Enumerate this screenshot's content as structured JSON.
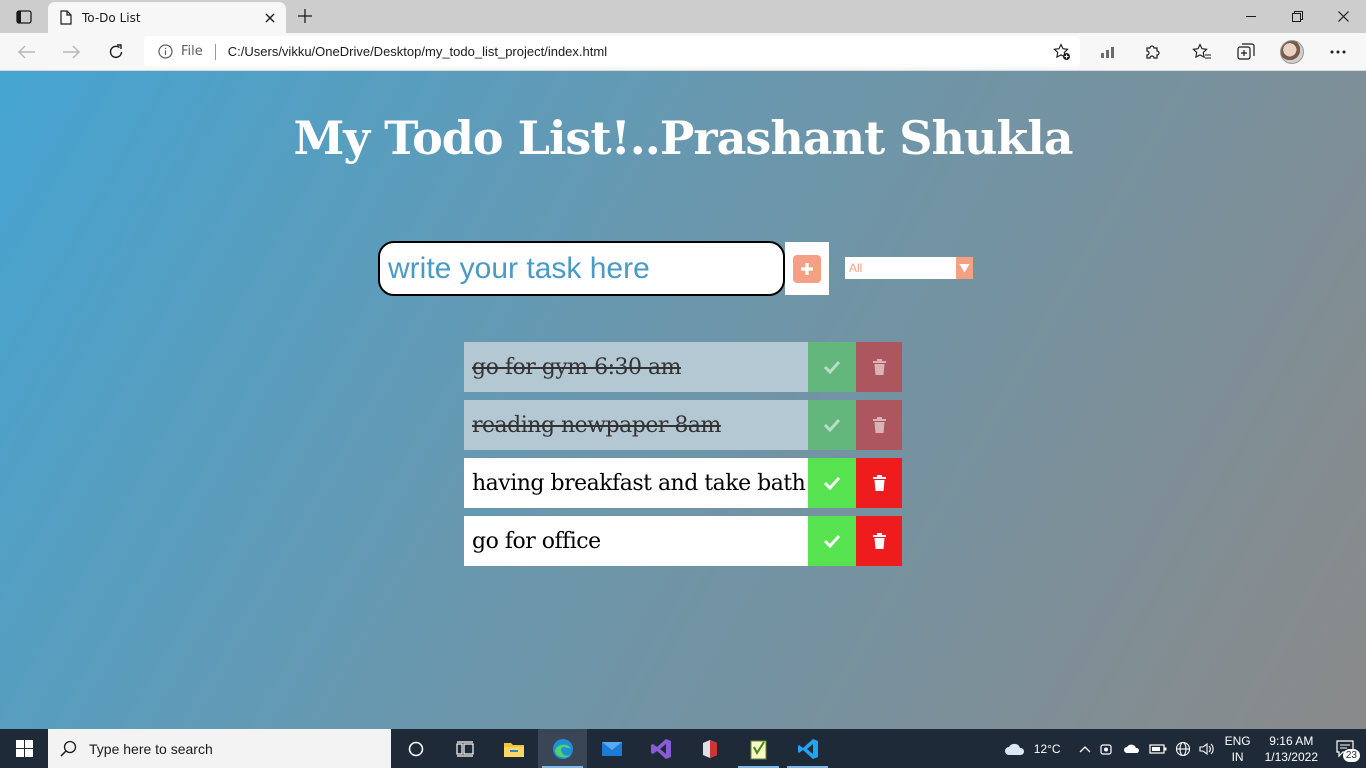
{
  "browser": {
    "tab_title": "To-Do List",
    "site_info_label": "File",
    "url": "C:/Users/vikku/OneDrive/Desktop/my_todo_list_project/index.html"
  },
  "page": {
    "heading": "My Todo List!..Prashant Shukla",
    "input_placeholder": "write your task here",
    "filter_selected": "All",
    "todos": [
      {
        "text": "go for gym 6:30 am",
        "completed": true
      },
      {
        "text": "reading newpaper 8am",
        "completed": true
      },
      {
        "text": "having breakfast and take bath",
        "completed": false
      },
      {
        "text": "go for office",
        "completed": false
      }
    ]
  },
  "taskbar": {
    "search_placeholder": "Type here to search",
    "weather": "12°C",
    "lang_primary": "ENG",
    "lang_secondary": "IN",
    "time": "9:16 AM",
    "date": "1/13/2022",
    "notification_count": "23"
  },
  "colors": {
    "accent_salmon": "#f4a084",
    "check_green": "#56e34f",
    "trash_red": "#ee1c1c"
  }
}
